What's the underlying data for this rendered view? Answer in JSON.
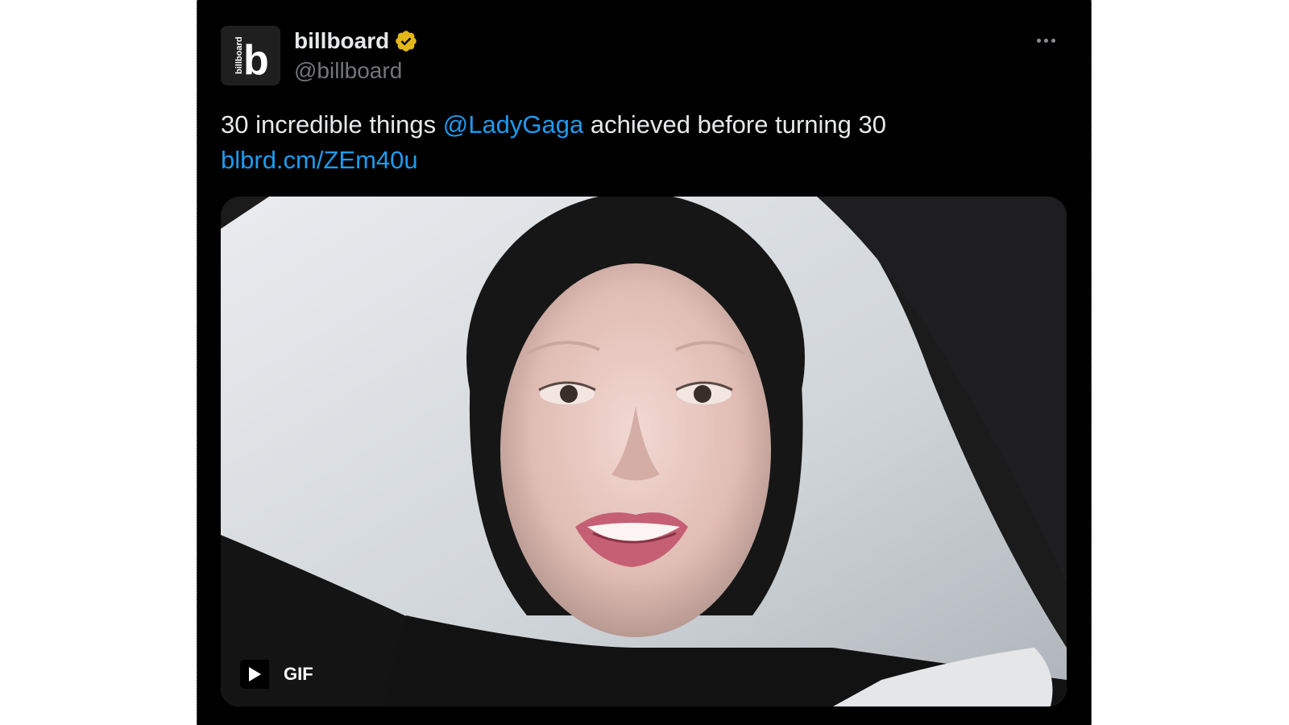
{
  "tweet": {
    "author_name": "billboard",
    "author_handle": "@billboard",
    "avatar_letter": "b",
    "avatar_wordmark": "billboard",
    "text_prefix": "30 incredible things ",
    "mention": "@LadyGaga",
    "text_suffix": " achieved before turning 30",
    "link": "blbrd.cm/ZEm40u",
    "media": {
      "type": "gif",
      "badge_label": "GIF"
    }
  },
  "icons": {
    "verified": "verified-badge-icon",
    "more": "more-options-icon",
    "play": "play-icon"
  },
  "colors": {
    "background": "#000000",
    "text": "#e7e9ea",
    "secondary_text": "#71767b",
    "link": "#1d9bf0",
    "verified_gold": "#e2b719"
  }
}
